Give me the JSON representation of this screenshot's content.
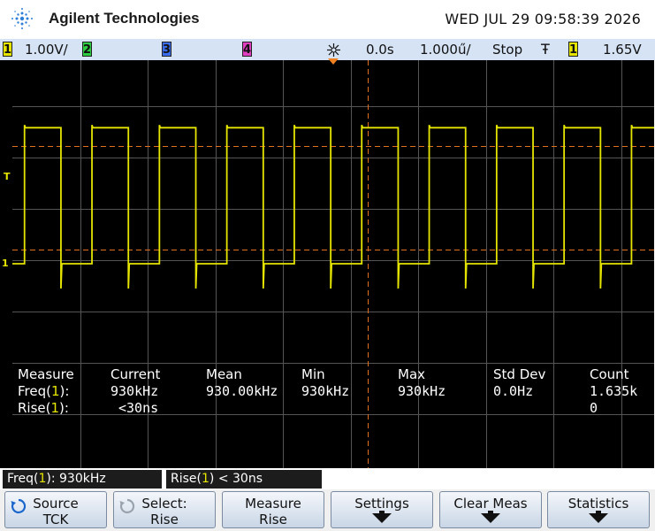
{
  "header": {
    "brand": "Agilent Technologies",
    "datetime": "WED JUL 29 09:58:39 2026"
  },
  "statusbar": {
    "ch1": {
      "num": "1",
      "scale": "1.00V/",
      "color": "#e5e500"
    },
    "ch2": {
      "num": "2",
      "color": "#2ecc40"
    },
    "ch3": {
      "num": "3",
      "color": "#3a6cf0"
    },
    "ch4": {
      "num": "4",
      "color": "#e040c0"
    },
    "delay": "0.0s",
    "timebase": "1.000ű/",
    "run_state": "Stop",
    "trigger_slope_glyph": "Ŧ",
    "trigger_source": "1",
    "trigger_level": "1.65V"
  },
  "screen": {
    "trigger_marker": "T",
    "ch1_marker": "1",
    "trace_color": "#e5e500",
    "cursor_color": "#e07020",
    "grid_color": "#555555",
    "waveform": {
      "low_level_div": 0,
      "high_level_div": 2.65,
      "rising_edges_div": [
        0.18,
        1.18,
        2.18,
        3.18,
        4.18,
        5.18,
        6.18,
        7.18,
        8.18,
        9.18
      ],
      "falling_edges_div": [
        0.72,
        1.72,
        2.72,
        3.72,
        4.72,
        5.72,
        6.72,
        7.72,
        8.72,
        9.72
      ]
    },
    "cursor_levels_div": [
      2.3,
      0.27
    ]
  },
  "measure": {
    "headers": [
      "Measure",
      "Current",
      "Mean",
      "Min",
      "Max",
      "Std Dev",
      "Count"
    ],
    "rows": [
      {
        "label_pre": "Freq(",
        "label_ch": "1",
        "label_post": "):",
        "current": "930kHz",
        "mean": "930.00kHz",
        "min": "930kHz",
        "max": "930kHz",
        "stddev": "0.0Hz",
        "count": "1.635k"
      },
      {
        "label_pre": "Rise(",
        "label_ch": "1",
        "label_post": "):",
        "current": "<30ns",
        "mean": "",
        "min": "",
        "max": "",
        "stddev": "",
        "count": "0"
      }
    ]
  },
  "readouts": [
    {
      "pre": "Freq(",
      "ch": "1",
      "post": "): 930kHz"
    },
    {
      "pre": "Rise(",
      "ch": "1",
      "post": ") < 30ns"
    }
  ],
  "softkeys": [
    {
      "line1": "Source",
      "line2": "TCK",
      "rotary": true
    },
    {
      "line1": "Select:",
      "line2": "Rise",
      "rotary": true
    },
    {
      "line1": "Measure",
      "line2": "Rise",
      "rotary": false
    },
    {
      "line1": "Settings",
      "line2": "",
      "arrow": true
    },
    {
      "line1": "Clear Meas",
      "line2": "",
      "arrow": true
    },
    {
      "line1": "Statistics",
      "line2": "",
      "arrow": true
    }
  ]
}
